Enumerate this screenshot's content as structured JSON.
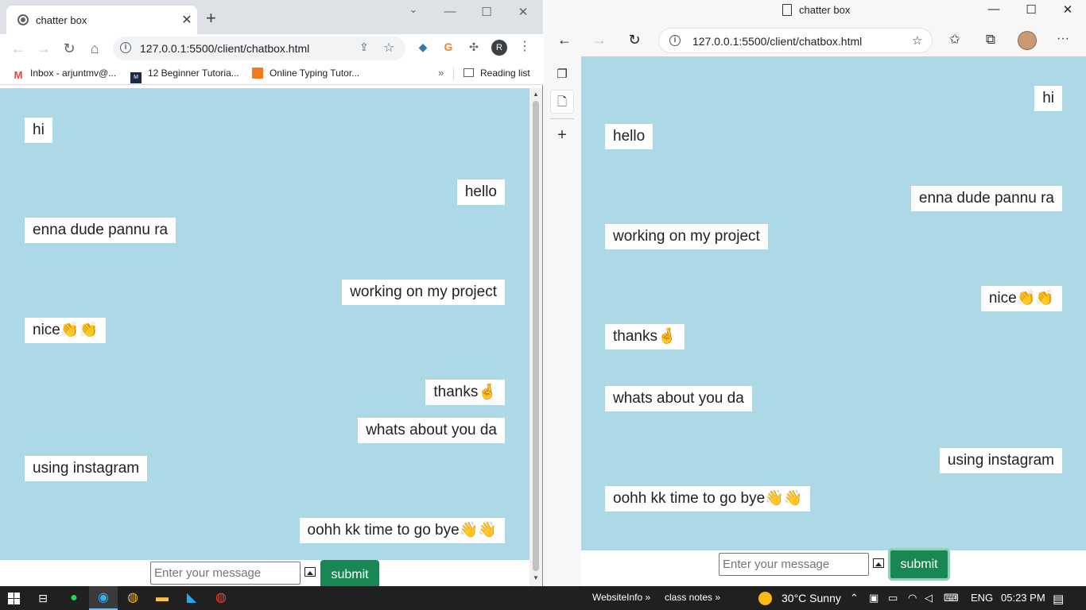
{
  "chrome": {
    "tab_title": "chatter box",
    "tab_close": "✕",
    "new_tab": "+",
    "url": "127.0.0.1:5500/client/chatbox.html",
    "avatar_letter": "R",
    "bookmarks": [
      {
        "label": "Inbox - arjuntmv@..."
      },
      {
        "label": "12 Beginner Tutoria..."
      },
      {
        "label": "Online Typing Tutor..."
      }
    ],
    "more_bookmarks": "»",
    "reading_list": "Reading list"
  },
  "chrome_messages": [
    {
      "text": "hi",
      "side": "left"
    },
    {
      "text": "hello",
      "side": "right"
    },
    {
      "text": "enna dude pannu ra",
      "side": "left"
    },
    {
      "text": "working on my project",
      "side": "right"
    },
    {
      "text": "nice👏👏",
      "side": "left"
    },
    {
      "text": "thanks🤞",
      "side": "right"
    },
    {
      "text": "whats about you da",
      "side": "right"
    },
    {
      "text": "using instagram",
      "side": "left"
    },
    {
      "text": "oohh kk time to go bye👋👋",
      "side": "right"
    }
  ],
  "edge": {
    "title": "chatter box",
    "url": "127.0.0.1:5500/client/chatbox.html"
  },
  "edge_messages": [
    {
      "text": "hi",
      "side": "right"
    },
    {
      "text": "hello",
      "side": "left"
    },
    {
      "text": "enna dude pannu ra",
      "side": "right"
    },
    {
      "text": "working on my project",
      "side": "left"
    },
    {
      "text": "nice👏👏",
      "side": "right"
    },
    {
      "text": "thanks🤞",
      "side": "left"
    },
    {
      "text": "whats about you da",
      "side": "left"
    },
    {
      "text": "using instagram",
      "side": "right"
    },
    {
      "text": "oohh kk time to go bye👋👋",
      "side": "left"
    }
  ],
  "chat_form": {
    "placeholder": "Enter your message",
    "submit_label": "submit"
  },
  "taskbar": {
    "links": [
      "WebsiteInfo",
      "class notes"
    ],
    "weather": "30°C  Sunny",
    "language": "ENG",
    "time": "05:23 PM"
  },
  "colors": {
    "chat_bg": "#add8e6",
    "submit_bg": "#198754"
  }
}
